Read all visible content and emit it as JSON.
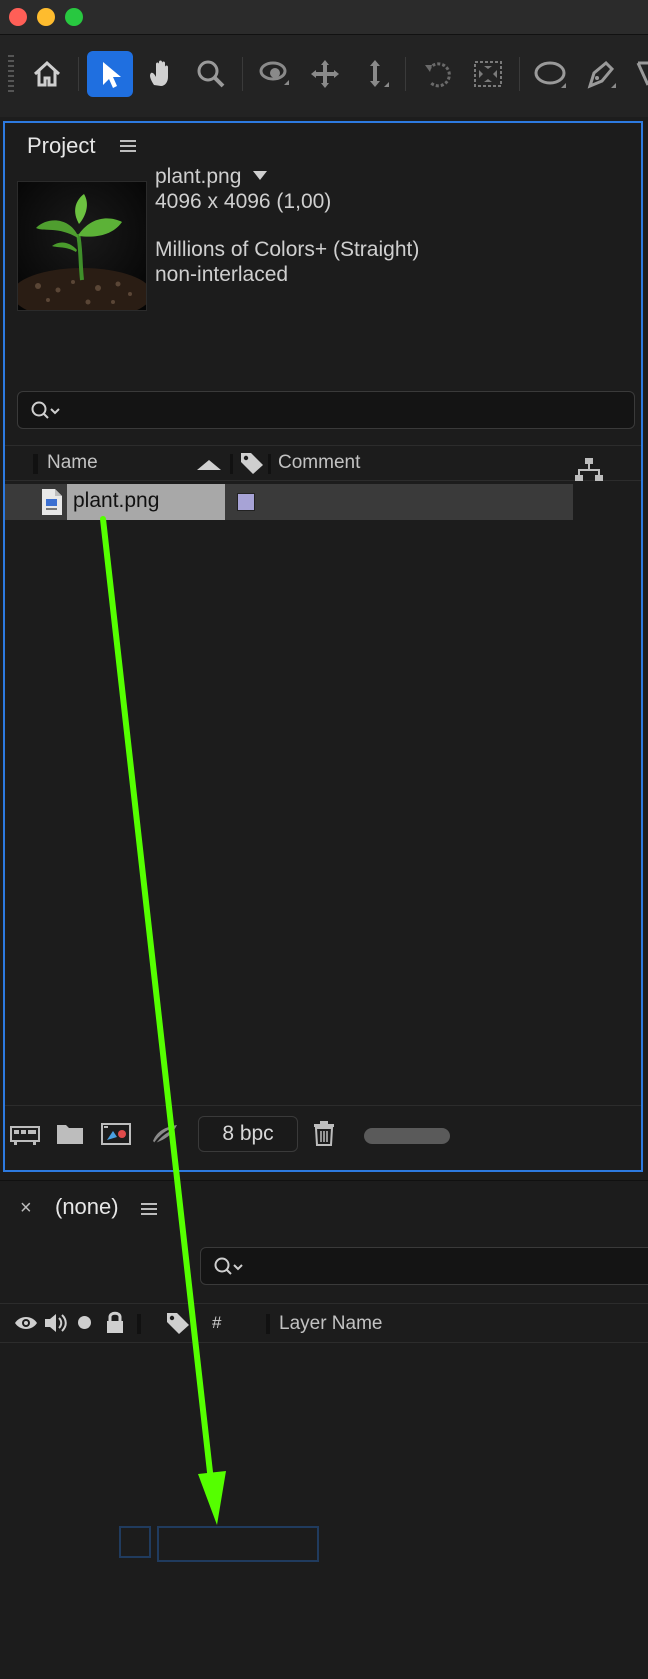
{
  "window": {
    "traffic_lights": {
      "close_color": "#ff5f57",
      "minimize_color": "#febc2e",
      "zoom_color": "#28c840"
    }
  },
  "toolbar": {
    "tools": [
      "home-icon",
      "selection-tool-icon",
      "hand-tool-icon",
      "zoom-tool-icon",
      "orbit-camera-icon",
      "pan-camera-icon",
      "dolly-camera-icon",
      "rotate-tool-icon",
      "pan-behind-icon",
      "ellipse-tool-icon",
      "pen-tool-icon"
    ],
    "active_tool": "selection-tool-icon",
    "accent_color": "#1f6fe0"
  },
  "project_panel": {
    "title": "Project",
    "footage": {
      "name": "plant.png",
      "dimensions": "4096 x 4096 (1,00)",
      "colors": "Millions of Colors+ (Straight)",
      "interlace": "non-interlaced"
    },
    "columns": {
      "name": "Name",
      "comment": "Comment"
    },
    "items": [
      {
        "name": "plant.png",
        "label_color": "#a7a3d6"
      }
    ],
    "bit_depth": "8 bpc"
  },
  "timeline_panel": {
    "comp_name": "(none)",
    "columns": {
      "number": "#",
      "layer_name": "Layer Name"
    }
  },
  "annotation": {
    "arrow_color": "#55ff00"
  }
}
